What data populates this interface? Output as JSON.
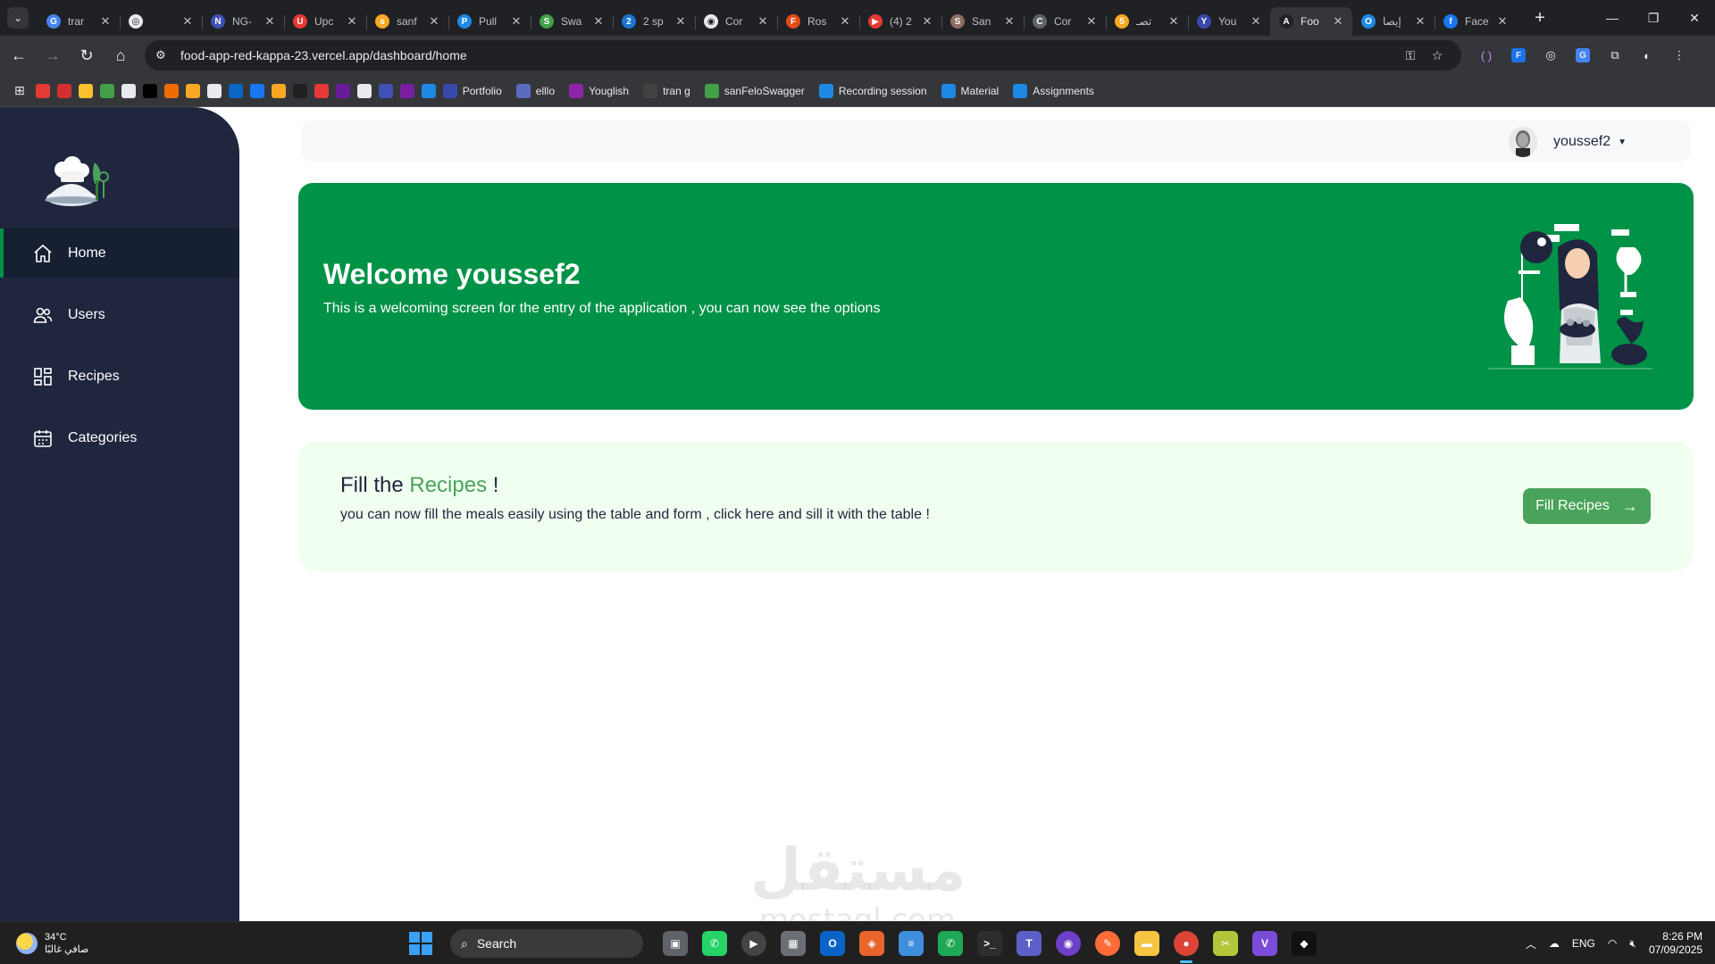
{
  "browser": {
    "tabs": [
      {
        "title": "trar",
        "color": "#4285f4",
        "glyph": "G"
      },
      {
        "title": "",
        "color": "#e8eaed",
        "glyph": "◎"
      },
      {
        "title": "NG-",
        "color": "#3f51b5",
        "glyph": "N"
      },
      {
        "title": "Upc",
        "color": "#e53935",
        "glyph": "U"
      },
      {
        "title": "sanf",
        "color": "#f9a825",
        "glyph": "s"
      },
      {
        "title": "Pull",
        "color": "#1e88e5",
        "glyph": "P"
      },
      {
        "title": "Swa",
        "color": "#43a047",
        "glyph": "S"
      },
      {
        "title": "2 sp",
        "color": "#1976d2",
        "glyph": "2"
      },
      {
        "title": "Cor",
        "color": "#e8eaed",
        "glyph": "◉"
      },
      {
        "title": "Ros",
        "color": "#e64a19",
        "glyph": "F"
      },
      {
        "title": "(4) 2",
        "color": "#e53935",
        "glyph": "▶"
      },
      {
        "title": "San",
        "color": "#8d6e63",
        "glyph": "S"
      },
      {
        "title": "Cor",
        "color": "#5f6368",
        "glyph": "C"
      },
      {
        "title": "تصـ",
        "color": "#f9a825",
        "glyph": "5"
      },
      {
        "title": "You",
        "color": "#3949ab",
        "glyph": "Y"
      },
      {
        "title": "Foo",
        "color": "#202124",
        "glyph": "A",
        "active": true
      },
      {
        "title": "إيصا",
        "color": "#1e88e5",
        "glyph": "O"
      },
      {
        "title": "Face",
        "color": "#1877f2",
        "glyph": "f"
      }
    ],
    "url": "food-app-red-kappa-23.vercel.app/dashboard/home",
    "bookmarks": [
      {
        "label": "Portfolio",
        "color": "#3949ab"
      },
      {
        "label": "elllo",
        "color": "#5c6bc0"
      },
      {
        "label": "Youglish",
        "color": "#8e24aa"
      },
      {
        "label": "tran g",
        "color": "#424242"
      },
      {
        "label": "sanFeloSwagger",
        "color": "#43a047"
      },
      {
        "label": "Recording session",
        "color": "#1e88e5"
      },
      {
        "label": "Material",
        "color": "#1e88e5"
      },
      {
        "label": "Assignments",
        "color": "#1e88e5"
      }
    ],
    "bookmark_icons": [
      "#e53935",
      "#d32f2f",
      "#fbc02d",
      "#43a047",
      "#e8eaed",
      "#000000",
      "#ef6c00",
      "#f9a825",
      "#e8eaed",
      "#0a66c2",
      "#1877f2",
      "#f9a825",
      "#212121",
      "#e53935",
      "#6a1b9a",
      "#e8eaed",
      "#3f51b5",
      "#7b1fa2",
      "#1e88e5"
    ]
  },
  "sidebar": {
    "items": [
      {
        "label": "Home",
        "icon": "home-icon",
        "active": true
      },
      {
        "label": "Users",
        "icon": "users-icon"
      },
      {
        "label": "Recipes",
        "icon": "recipes-grid-icon"
      },
      {
        "label": "Categories",
        "icon": "calendar-icon"
      }
    ]
  },
  "topnav": {
    "username": "youssef2"
  },
  "hero": {
    "title": "Welcome youssef2",
    "subtitle": "This is a welcoming screen for the entry of the application , you can now see the options"
  },
  "fill_card": {
    "title_prefix": "Fill the ",
    "title_accent": "Recipes",
    "title_suffix": " !",
    "subtitle": "you can now fill the meals easily using the table and form , click here and sill it with the table !",
    "button_label": "Fill Recipes"
  },
  "watermark": {
    "arabic": "مستقل",
    "latin": "mostaql.com"
  },
  "taskbar": {
    "weather_temp": "34°C",
    "weather_desc": "صافي غالبًا",
    "search_label": "Search",
    "lang": "ENG",
    "time": "8:26 PM",
    "date": "07/09/2025"
  },
  "colors": {
    "sidebar": "#1f263e",
    "primary_green": "#009247",
    "accent_green": "#4aa35a",
    "card_bg": "#f0fff0"
  }
}
